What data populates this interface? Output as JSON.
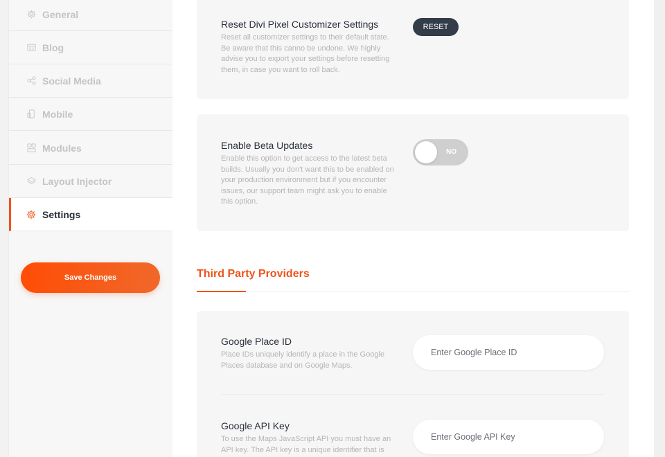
{
  "sidebar": {
    "items": [
      {
        "label": "General",
        "icon": "gear-icon"
      },
      {
        "label": "Blog",
        "icon": "blog-icon"
      },
      {
        "label": "Social Media",
        "icon": "share-icon"
      },
      {
        "label": "Mobile",
        "icon": "mobile-icon"
      },
      {
        "label": "Modules",
        "icon": "modules-icon"
      },
      {
        "label": "Layout Injector",
        "icon": "layers-icon"
      },
      {
        "label": "Settings",
        "icon": "gear-icon",
        "active": true
      }
    ],
    "save_label": "Save Changes"
  },
  "reset": {
    "title": "Reset Divi Pixel Customizer Settings",
    "description": "Reset all customizer settings to their default state. Be aware that this canno be undone. We highly advise you to export your settings before resetting them, in case you want to roll back.",
    "button_label": "RESET"
  },
  "beta": {
    "title": "Enable Beta Updates",
    "description": "Enable this option to get access to the latest beta builds. Usually you don't want this to be enabled on your production environment but if you encounter issues, our support team might ask you to enable this option.",
    "toggle_label": "NO"
  },
  "third_party": {
    "title": "Third Party Providers",
    "place_id": {
      "title": "Google Place ID",
      "description": "Place IDs uniquely identify a place in the Google Places database and on Google Maps.",
      "placeholder": "Enter Google Place ID"
    },
    "api_key": {
      "title": "Google API Key",
      "description": "To use the Maps JavaScript API you must have an API key. The API key is a unique identifier that is",
      "placeholder": "Enter Google API Key"
    }
  },
  "colors": {
    "accent": "#f0531a",
    "dark_button": "#333d49"
  }
}
